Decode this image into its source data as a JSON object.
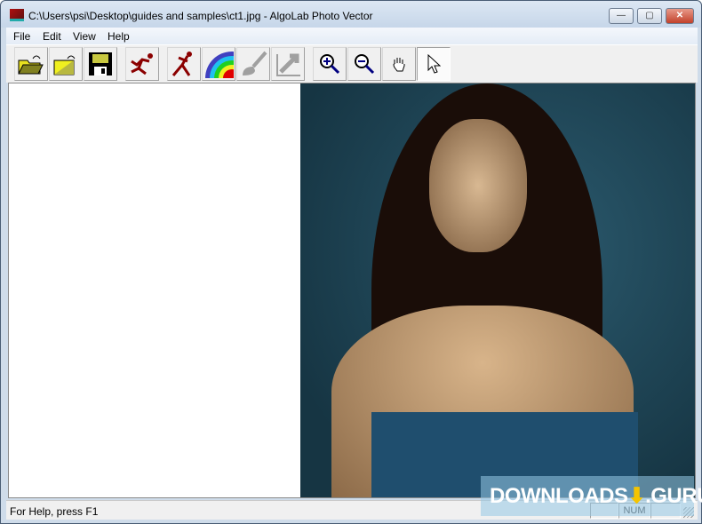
{
  "window": {
    "title": "C:\\Users\\psi\\Desktop\\guides and samples\\ct1.jpg - AlgoLab Photo Vector"
  },
  "menu": [
    "File",
    "Edit",
    "View",
    "Help"
  ],
  "toolbar": [
    {
      "name": "open-icon"
    },
    {
      "name": "open-image-icon"
    },
    {
      "name": "save-icon"
    },
    {
      "name": "run-icon"
    },
    {
      "name": "vectorize-icon"
    },
    {
      "name": "palette-icon"
    },
    {
      "name": "brush-icon"
    },
    {
      "name": "export-icon"
    },
    {
      "name": "zoom-in-icon"
    },
    {
      "name": "zoom-out-icon"
    },
    {
      "name": "hand-icon"
    },
    {
      "name": "pointer-icon"
    }
  ],
  "status": {
    "text": "For Help, press F1",
    "num": "NUM"
  },
  "watermark": {
    "text": "DOWNLOADS",
    "suffix": ".GURU"
  }
}
